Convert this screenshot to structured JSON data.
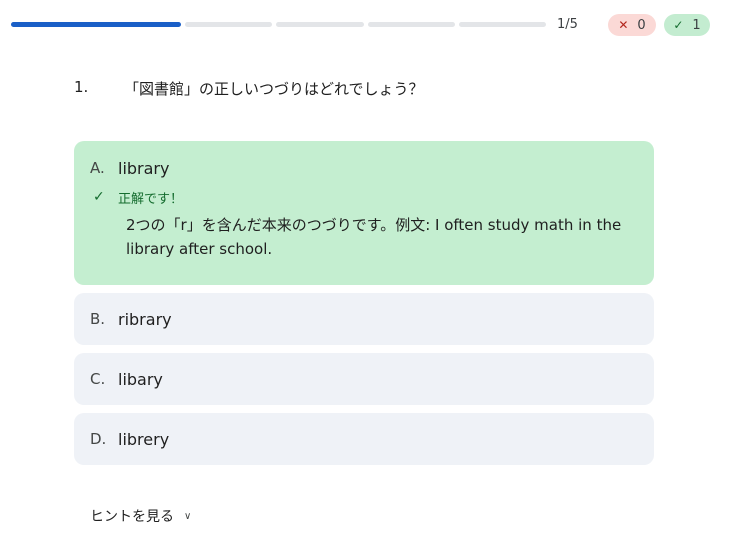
{
  "progress": {
    "counter": "1/5",
    "current": 1,
    "total": 5,
    "wrong_count": "0",
    "right_count": "1",
    "colors": {
      "filled": "#1a5fc7",
      "empty": "#e3e5e8",
      "wrong_badge": "#fbd9d6",
      "right_badge": "#c3ecd0"
    },
    "icons": {
      "wrong": "close-icon",
      "right": "check-icon"
    }
  },
  "question": {
    "number": "1.",
    "text": "「図書館」の正しいつづりはどれでしょう？"
  },
  "options": [
    {
      "letter": "A.",
      "text": "library",
      "state": "correct"
    },
    {
      "letter": "B.",
      "text": "ribrary",
      "state": "default"
    },
    {
      "letter": "C.",
      "text": "libary",
      "state": "default"
    },
    {
      "letter": "D.",
      "text": "librery",
      "state": "default"
    }
  ],
  "feedback": {
    "title": "正解です！",
    "text": "2つの「r」を含んだ本来のつづりです。例文: I often study math in the library after school.",
    "icon": "check-icon",
    "color": "#146c2e",
    "background": "#c4eed0"
  },
  "hint": {
    "label": "ヒントを見る",
    "icon": "chevron-down-icon"
  }
}
